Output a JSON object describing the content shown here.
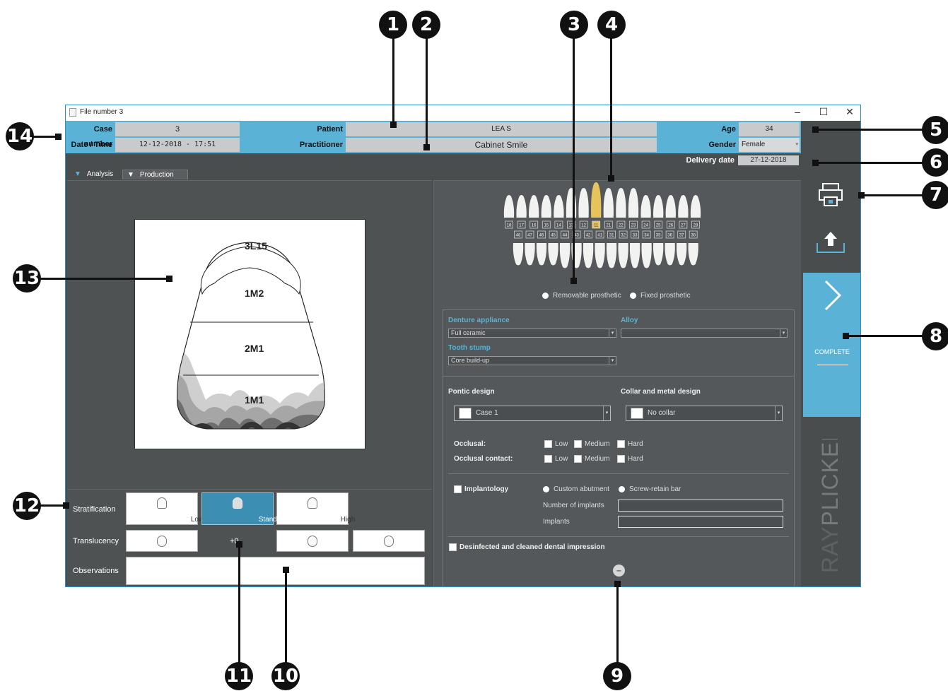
{
  "window": {
    "title": "File number 3",
    "minimize": "–",
    "maximize": "☐",
    "close": "✕"
  },
  "case": {
    "case_number_label": "Case number",
    "case_number": "3",
    "date_time_label": "Date / Time",
    "date_time": "12-12-2018 - 17:51",
    "patient_label": "Patient",
    "patient": "LEA S",
    "practitioner_label": "Practitioner",
    "practitioner": "Cabinet Smile",
    "age_label": "Age",
    "age": "34",
    "gender_label": "Gender",
    "gender": "Female",
    "delivery_label": "Delivery date",
    "delivery": "27-12-2018"
  },
  "tabs": {
    "analysis": "Analysis",
    "production": "Production"
  },
  "shade_map": {
    "zones": [
      "3L15",
      "1M2",
      "2M1",
      "1M1"
    ]
  },
  "stratification": {
    "label": "Stratification",
    "options": [
      "Low",
      "Standard",
      "High"
    ],
    "selected": "Standard"
  },
  "translucency": {
    "label": "Translucency",
    "value": "+0"
  },
  "observations": {
    "label": "Observations",
    "value": ""
  },
  "teeth": {
    "upper": [
      "18",
      "17",
      "16",
      "15",
      "14",
      "13",
      "12",
      "11",
      "21",
      "22",
      "23",
      "24",
      "25",
      "26",
      "27",
      "28"
    ],
    "lower": [
      "48",
      "47",
      "46",
      "45",
      "44",
      "43",
      "42",
      "41",
      "31",
      "32",
      "33",
      "34",
      "35",
      "36",
      "37",
      "38"
    ],
    "selected": "11",
    "prosthetic_options": [
      "Removable prosthetic",
      "Fixed prosthetic"
    ]
  },
  "form": {
    "denture_label": "Denture appliance",
    "denture_value": "Full ceramic",
    "alloy_label": "Alloy",
    "alloy_value": "",
    "stump_label": "Tooth stump",
    "stump_value": "Core build-up",
    "pontic_label": "Pontic design",
    "pontic_value": "Case 1",
    "collar_label": "Collar and metal design",
    "collar_value": "No collar",
    "occlusal_label": "Occlusal:",
    "occlusal_contact_label": "Occlusal contact:",
    "levels": [
      "Low",
      "Medium",
      "Hard"
    ],
    "implantology_label": "Implantology",
    "implant_options": [
      "Custom abutment",
      "Screw-retain bar"
    ],
    "num_implants_label": "Number of implants",
    "implants_label": "Implants",
    "disinfected_label": "Desinfected and cleaned dental impression",
    "collapse": "–"
  },
  "sidebar": {
    "complete_label": "COMPLETE",
    "brand": "RAYPLICKER",
    "brand_colors": {
      "ray": "#5f6264",
      "plicker": "#777b7d"
    }
  },
  "callouts": [
    "1",
    "2",
    "3",
    "4",
    "5",
    "6",
    "7",
    "8",
    "9",
    "10",
    "11",
    "12",
    "13",
    "14"
  ],
  "colors": {
    "accent": "#5ab3d6",
    "panel": "#4a4d4e",
    "selected_tooth": "#e6c45b"
  }
}
